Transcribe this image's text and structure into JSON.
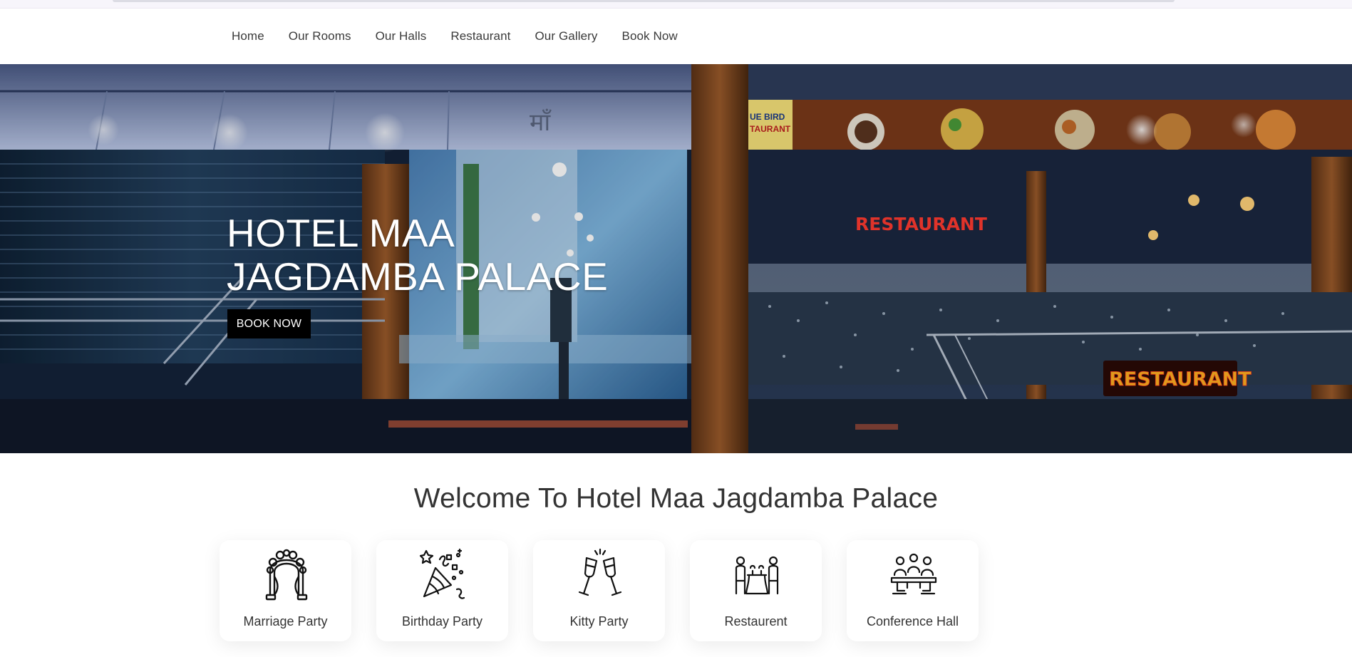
{
  "nav": {
    "items": [
      "Home",
      "Our Rooms",
      "Our Halls",
      "Restaurant",
      "Our Gallery",
      "Book Now"
    ]
  },
  "hero": {
    "title_line1": "HOTEL MAA",
    "title_line2": "JAGDAMBA PALACE",
    "button": "BOOK NOW",
    "image": {
      "signs": [
        "RESTAURANT",
        "RESTAURANT"
      ],
      "banner_text": "UE BIRD TAURANT",
      "devanagari": "माँ"
    }
  },
  "welcome": {
    "title": "Welcome To Hotel Maa Jagdamba Palace"
  },
  "services": [
    {
      "label": "Marriage Party",
      "icon": "wedding-arch-icon"
    },
    {
      "label": "Birthday Party",
      "icon": "party-popper-icon"
    },
    {
      "label": "Kitty Party",
      "icon": "champagne-glasses-icon"
    },
    {
      "label": "Restaurent",
      "icon": "dining-table-icon"
    },
    {
      "label": "Conference Hall",
      "icon": "meeting-table-icon"
    }
  ],
  "colors": {
    "nav_text": "#3a3a3a",
    "button_bg": "#000000",
    "button_text": "#ffffff",
    "sign_red": "#ff3b30"
  }
}
